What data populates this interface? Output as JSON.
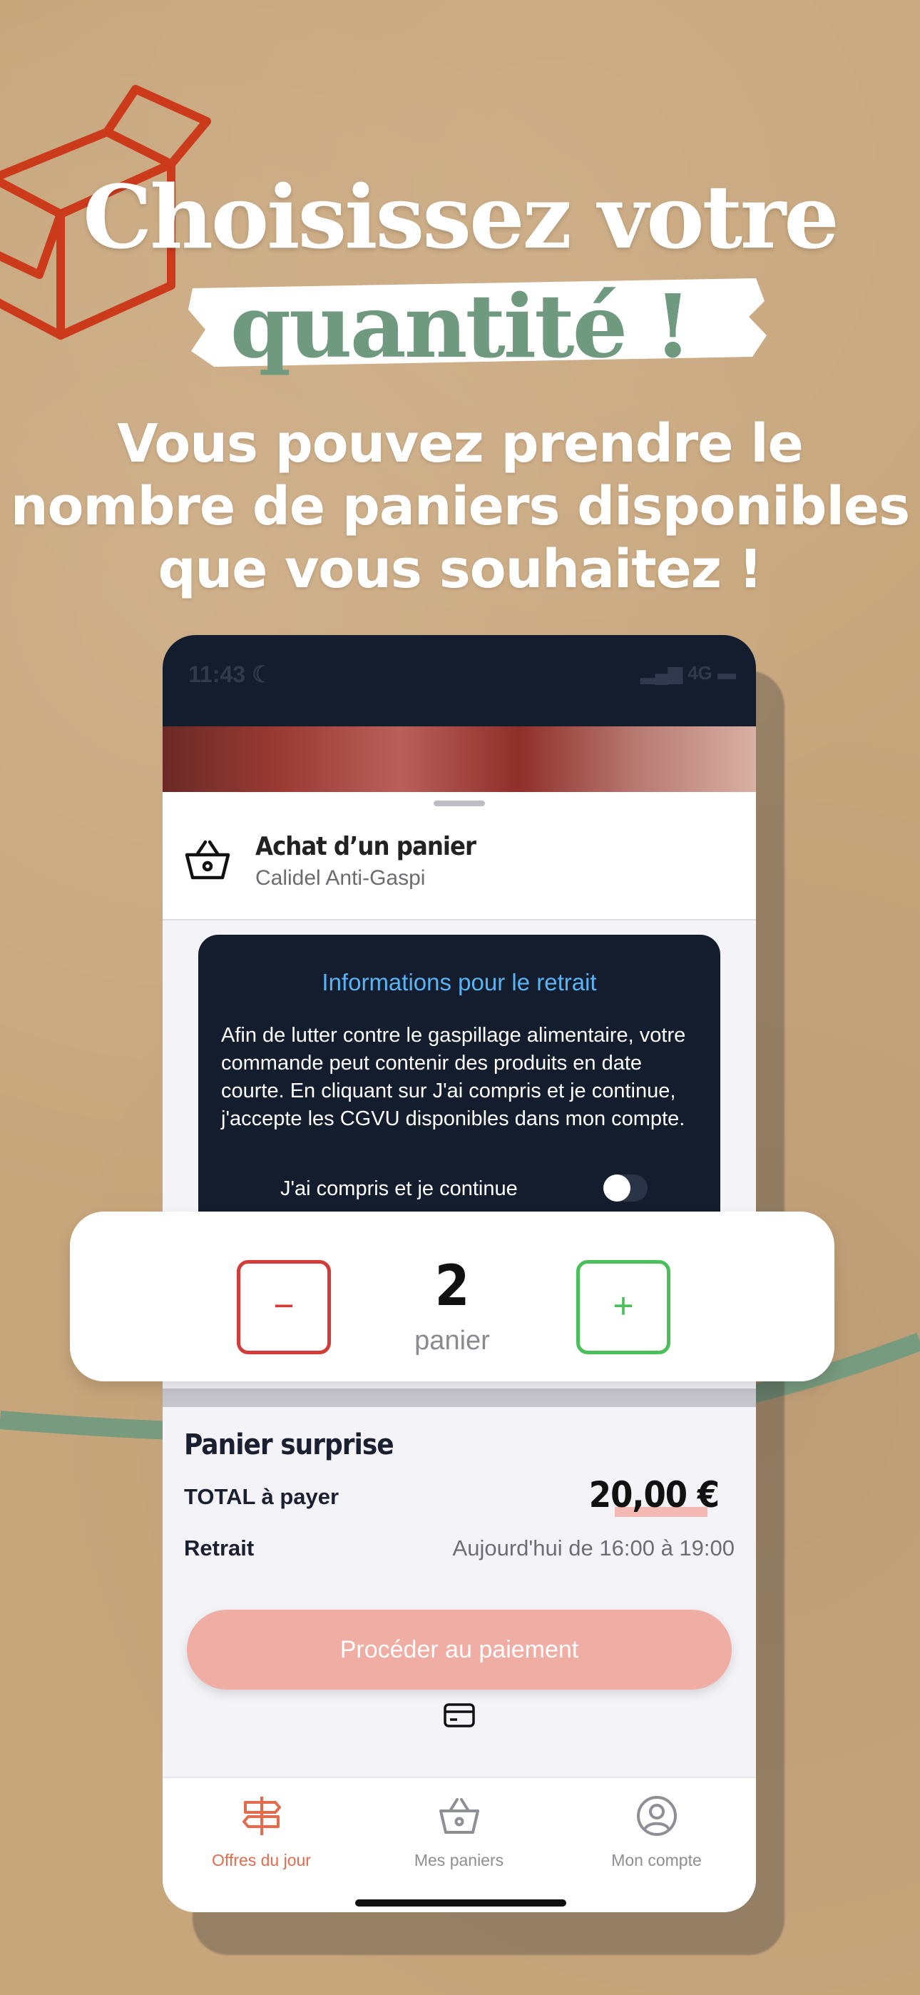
{
  "header": {
    "title_line1": "Choisissez votre",
    "title_line2": "quantité !",
    "subtitle_line1": "Vous pouvez prendre le",
    "subtitle_line2": "nombre de paniers disponibles",
    "subtitle_line3": "que vous souhaitez !"
  },
  "colors": {
    "accent_red": "#d23b37",
    "accent_green": "#6f9a7f",
    "plus_green": "#49c05a",
    "dark_navy": "#141d2e",
    "pay_button": "#f0ada3",
    "info_blue": "#5ab4f2"
  },
  "status_bar": {
    "time": "11:43",
    "network": "4G"
  },
  "sheet": {
    "title": "Achat d’un panier",
    "subtitle": "Calidel Anti-Gaspi"
  },
  "info_card": {
    "title": "Informations pour le retrait",
    "body": "Afin de lutter contre le gaspillage alimentaire, votre commande peut contenir des produits en date courte. En cliquant sur J'ai compris et je continue, j'accepte les CGVU disponibles dans mon compte.",
    "toggle_label": "J'ai compris et je continue",
    "toggle_on": false
  },
  "quantity": {
    "minus": "−",
    "plus": "+",
    "value": "2",
    "unit": "panier"
  },
  "order": {
    "basket_name": "Panier surprise",
    "total_label": "TOTAL à payer",
    "total_value": "20,00 €",
    "pickup_label": "Retrait",
    "pickup_value": "Aujourd'hui de 16:00 à 19:00",
    "pay_button": "Procéder au paiement"
  },
  "tabs": [
    {
      "label": "Offres du jour",
      "icon": "signpost-icon",
      "active": true
    },
    {
      "label": "Mes paniers",
      "icon": "basket-icon",
      "active": false
    },
    {
      "label": "Mon compte",
      "icon": "user-circle-icon",
      "active": false
    }
  ]
}
